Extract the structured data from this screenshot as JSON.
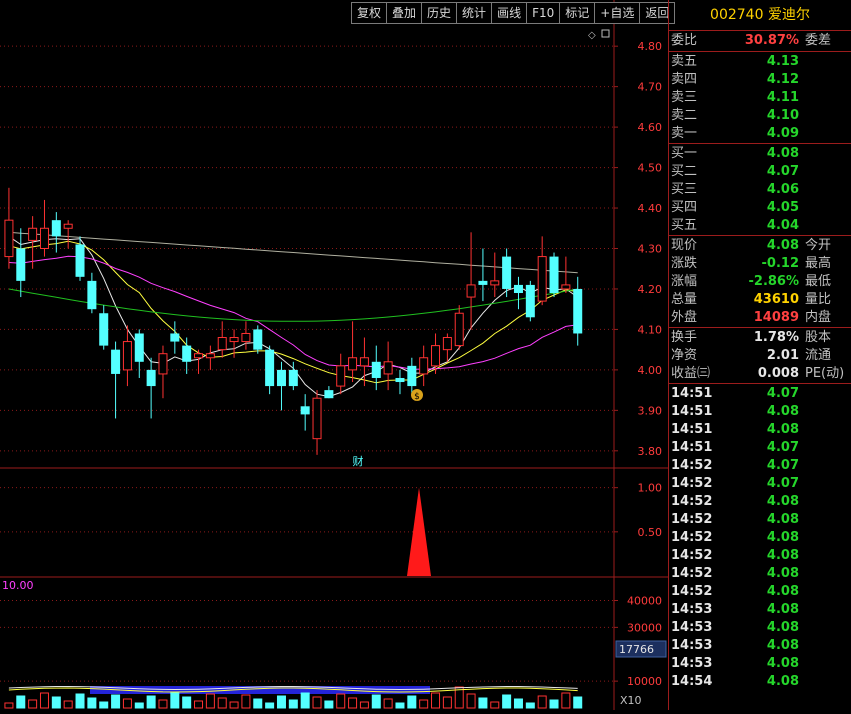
{
  "toolbar": [
    "复权",
    "叠加",
    "历史",
    "统计",
    "画线",
    "F10",
    "标记",
    "+自选",
    "返回"
  ],
  "price_axis": [
    "4.80",
    "4.70",
    "4.60",
    "4.50",
    "4.40",
    "4.30",
    "4.20",
    "4.10",
    "4.00",
    "3.90",
    "3.80"
  ],
  "indicator_axis": [
    "1.00",
    "0.50"
  ],
  "volume_axis": [
    "40000",
    "30000",
    "10000"
  ],
  "volume_label": "10.00",
  "volume_current": "17766",
  "volume_scale": "X10",
  "fin_label": "财",
  "stock": {
    "code": "002740",
    "name": "爱迪尔"
  },
  "weibi": {
    "label": "委比",
    "value": "30.87%",
    "label2": "委差"
  },
  "sell": [
    {
      "label": "卖五",
      "price": "4.13"
    },
    {
      "label": "卖四",
      "price": "4.12"
    },
    {
      "label": "卖三",
      "price": "4.11"
    },
    {
      "label": "卖二",
      "price": "4.10"
    },
    {
      "label": "卖一",
      "price": "4.09"
    }
  ],
  "buy": [
    {
      "label": "买一",
      "price": "4.08"
    },
    {
      "label": "买二",
      "price": "4.07"
    },
    {
      "label": "买三",
      "price": "4.06"
    },
    {
      "label": "买四",
      "price": "4.05"
    },
    {
      "label": "买五",
      "price": "4.04"
    }
  ],
  "quote": [
    {
      "label": "现价",
      "value": "4.08",
      "label2": "今开",
      "color": "#25d62b"
    },
    {
      "label": "涨跌",
      "value": "-0.12",
      "label2": "最高",
      "color": "#25d62b"
    },
    {
      "label": "涨幅",
      "value": "-2.86%",
      "label2": "最低",
      "color": "#25d62b"
    },
    {
      "label": "总量",
      "value": "43610",
      "label2": "量比",
      "color": "#ffd200"
    },
    {
      "label": "外盘",
      "value": "14089",
      "label2": "内盘",
      "color": "#ff4040"
    }
  ],
  "stats": [
    {
      "label": "换手",
      "value": "1.78%",
      "label2": "股本"
    },
    {
      "label": "净资",
      "value": "2.01",
      "label2": "流通"
    },
    {
      "label": "收益㈢",
      "value": "0.008",
      "label2": "PE(动)"
    }
  ],
  "ticks": [
    {
      "time": "14:51",
      "price": "4.07"
    },
    {
      "time": "14:51",
      "price": "4.08"
    },
    {
      "time": "14:51",
      "price": "4.08"
    },
    {
      "time": "14:51",
      "price": "4.07"
    },
    {
      "time": "14:52",
      "price": "4.07"
    },
    {
      "time": "14:52",
      "price": "4.07"
    },
    {
      "time": "14:52",
      "price": "4.08"
    },
    {
      "time": "14:52",
      "price": "4.08"
    },
    {
      "time": "14:52",
      "price": "4.08"
    },
    {
      "time": "14:52",
      "price": "4.08"
    },
    {
      "time": "14:52",
      "price": "4.08"
    },
    {
      "time": "14:52",
      "price": "4.08"
    },
    {
      "time": "14:53",
      "price": "4.08"
    },
    {
      "time": "14:53",
      "price": "4.08"
    },
    {
      "time": "14:53",
      "price": "4.08"
    },
    {
      "time": "14:53",
      "price": "4.08"
    },
    {
      "time": "14:54",
      "price": "4.08"
    }
  ],
  "colors": {
    "up": "#ff3232",
    "down": "#54ffff",
    "grid": "#8b1a1a",
    "axis_text": "#ff3c3c",
    "ma5": "#e8e8e8",
    "ma10": "#ffff40",
    "ma20": "#ff40ff",
    "ma60": "#20c020",
    "ma120": "#b0b0a0"
  },
  "chart_data": {
    "type": "candlestick",
    "ylim": [
      3.76,
      4.84
    ],
    "candles": [
      {
        "o": 4.28,
        "c": 4.37,
        "h": 4.45,
        "l": 4.25
      },
      {
        "o": 4.3,
        "c": 4.22,
        "h": 4.35,
        "l": 4.18
      },
      {
        "o": 4.32,
        "c": 4.35,
        "h": 4.38,
        "l": 4.25
      },
      {
        "o": 4.3,
        "c": 4.35,
        "h": 4.42,
        "l": 4.28
      },
      {
        "o": 4.37,
        "c": 4.33,
        "h": 4.39,
        "l": 4.29
      },
      {
        "o": 4.35,
        "c": 4.36,
        "h": 4.37,
        "l": 4.3
      },
      {
        "o": 4.31,
        "c": 4.23,
        "h": 4.33,
        "l": 4.22
      },
      {
        "o": 4.22,
        "c": 4.15,
        "h": 4.24,
        "l": 4.14
      },
      {
        "o": 4.14,
        "c": 4.06,
        "h": 4.16,
        "l": 4.05
      },
      {
        "o": 4.05,
        "c": 3.99,
        "h": 4.07,
        "l": 3.88
      },
      {
        "o": 4.0,
        "c": 4.07,
        "h": 4.11,
        "l": 3.96
      },
      {
        "o": 4.09,
        "c": 4.02,
        "h": 4.1,
        "l": 3.98
      },
      {
        "o": 4.0,
        "c": 3.96,
        "h": 4.03,
        "l": 3.88
      },
      {
        "o": 3.99,
        "c": 4.04,
        "h": 4.06,
        "l": 3.93
      },
      {
        "o": 4.09,
        "c": 4.07,
        "h": 4.12,
        "l": 4.04
      },
      {
        "o": 4.06,
        "c": 4.02,
        "h": 4.08,
        "l": 3.99
      },
      {
        "o": 4.03,
        "c": 4.04,
        "h": 4.05,
        "l": 3.99
      },
      {
        "o": 4.03,
        "c": 4.04,
        "h": 4.06,
        "l": 4.0
      },
      {
        "o": 4.05,
        "c": 4.08,
        "h": 4.12,
        "l": 4.03
      },
      {
        "o": 4.07,
        "c": 4.08,
        "h": 4.1,
        "l": 4.03
      },
      {
        "o": 4.07,
        "c": 4.09,
        "h": 4.12,
        "l": 4.05
      },
      {
        "o": 4.1,
        "c": 4.05,
        "h": 4.11,
        "l": 4.04
      },
      {
        "o": 4.05,
        "c": 3.96,
        "h": 4.06,
        "l": 3.94
      },
      {
        "o": 4.0,
        "c": 3.96,
        "h": 4.02,
        "l": 3.9
      },
      {
        "o": 4.0,
        "c": 3.96,
        "h": 4.02,
        "l": 3.95
      },
      {
        "o": 3.91,
        "c": 3.89,
        "h": 3.94,
        "l": 3.85
      },
      {
        "o": 3.83,
        "c": 3.93,
        "h": 3.95,
        "l": 3.79
      },
      {
        "o": 3.95,
        "c": 3.93,
        "h": 3.96,
        "l": 3.93
      },
      {
        "o": 3.96,
        "c": 4.01,
        "h": 4.04,
        "l": 3.94
      },
      {
        "o": 4.0,
        "c": 4.03,
        "h": 4.12,
        "l": 3.97
      },
      {
        "o": 4.01,
        "c": 4.03,
        "h": 4.08,
        "l": 3.96
      },
      {
        "o": 4.02,
        "c": 3.98,
        "h": 4.06,
        "l": 3.95
      },
      {
        "o": 3.99,
        "c": 4.02,
        "h": 4.07,
        "l": 3.95
      },
      {
        "o": 3.98,
        "c": 3.97,
        "h": 4.0,
        "l": 3.94
      },
      {
        "o": 4.01,
        "c": 3.96,
        "h": 4.03,
        "l": 3.94
      },
      {
        "o": 3.99,
        "c": 4.03,
        "h": 4.06,
        "l": 3.96
      },
      {
        "o": 4.01,
        "c": 4.06,
        "h": 4.09,
        "l": 3.99
      },
      {
        "o": 4.05,
        "c": 4.08,
        "h": 4.09,
        "l": 4.02
      },
      {
        "o": 4.06,
        "c": 4.14,
        "h": 4.16,
        "l": 4.05
      },
      {
        "o": 4.18,
        "c": 4.21,
        "h": 4.34,
        "l": 4.1
      },
      {
        "o": 4.22,
        "c": 4.21,
        "h": 4.3,
        "l": 4.17
      },
      {
        "o": 4.21,
        "c": 4.22,
        "h": 4.29,
        "l": 4.18
      },
      {
        "o": 4.28,
        "c": 4.2,
        "h": 4.3,
        "l": 4.18
      },
      {
        "o": 4.21,
        "c": 4.19,
        "h": 4.23,
        "l": 4.15
      },
      {
        "o": 4.21,
        "c": 4.13,
        "h": 4.22,
        "l": 4.12
      },
      {
        "o": 4.17,
        "c": 4.28,
        "h": 4.33,
        "l": 4.16
      },
      {
        "o": 4.28,
        "c": 4.19,
        "h": 4.29,
        "l": 4.18
      },
      {
        "o": 4.2,
        "c": 4.21,
        "h": 4.28,
        "l": 4.19
      },
      {
        "o": 4.2,
        "c": 4.09,
        "h": 4.23,
        "l": 4.06
      }
    ],
    "indicator": {
      "ylim": [
        0,
        1.2
      ],
      "spike_value": 1.0
    }
  }
}
